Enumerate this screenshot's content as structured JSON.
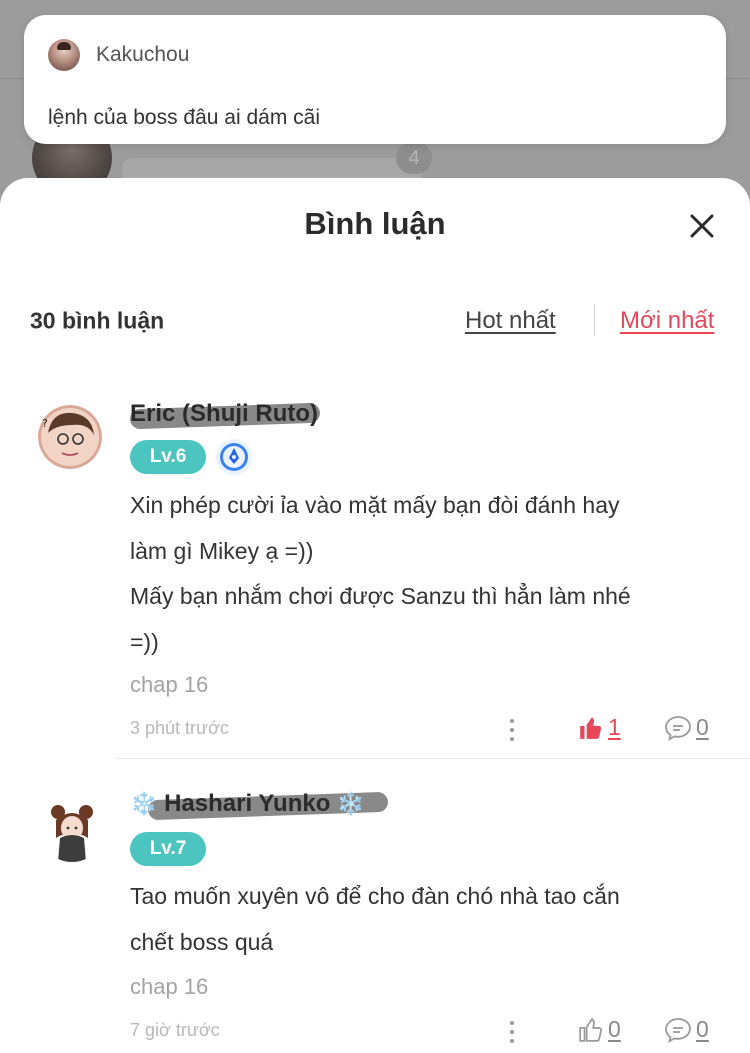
{
  "background": {
    "unread_count": "4"
  },
  "preview": {
    "author": "Kakuchou",
    "text": "lệnh của boss đâu ai dám cãi"
  },
  "sheet": {
    "title": "Bình luận",
    "comment_count": "30 bình luận",
    "sort_tabs": {
      "hot": "Hot nhất",
      "new": "Mới nhất",
      "active": "new"
    }
  },
  "comments": [
    {
      "name": "Eric (Shuji Ruto)",
      "level": "Lv.6",
      "has_pen_badge": true,
      "text_lines": [
        "Xin phép cười ỉa vào mặt mấy bạn đòi đánh hay",
        "làm gì Mikey ạ =))",
        "Mấy bạn nhắm chơi được Sanzu thì hẳn làm nhé",
        "=))"
      ],
      "chapter": "chap 16",
      "time": "3 phút trước",
      "likes": "1",
      "liked": true,
      "replies": "0"
    },
    {
      "name": "Hashari Yunko",
      "name_decoration": "❄️",
      "level": "Lv.7",
      "has_pen_badge": false,
      "text_lines": [
        "Tao muốn xuyên vô để cho đàn chó nhà tao cắn",
        "chết boss quá"
      ],
      "chapter": "chap 16",
      "time": "7 giờ trước",
      "likes": "0",
      "liked": false,
      "replies": "0"
    }
  ],
  "colors": {
    "accent": "#e8475a",
    "level_badge": "#4cc4c0",
    "overlay": "#9a9a9a"
  },
  "icons": [
    "close-icon",
    "pen-badge-icon",
    "more-icon",
    "thumbs-up-icon",
    "comment-bubble-icon",
    "snowflake-icon"
  ]
}
